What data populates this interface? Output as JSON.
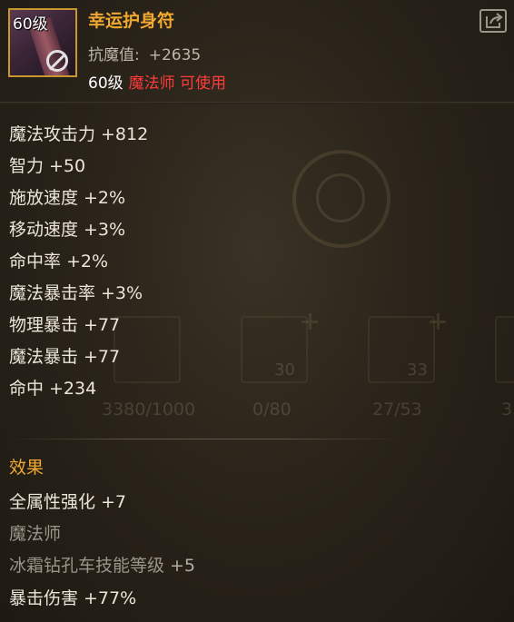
{
  "item": {
    "level_badge": "60级",
    "name": "幸运护身符",
    "resist_label": "抗魔值:",
    "resist_value": "+2635",
    "req_level": "60级",
    "req_class": "魔法师 可使用"
  },
  "stats": [
    {
      "label": "魔法攻击力",
      "value": "+812"
    },
    {
      "label": "智力",
      "value": "+50"
    },
    {
      "label": "施放速度",
      "value": "+2%"
    },
    {
      "label": "移动速度",
      "value": "+3%"
    },
    {
      "label": "命中率",
      "value": "+2%"
    },
    {
      "label": "魔法暴击率",
      "value": "+3%"
    },
    {
      "label": "物理暴击",
      "value": "+77"
    },
    {
      "label": "魔法暴击",
      "value": "+77"
    },
    {
      "label": "命中",
      "value": "+234"
    }
  ],
  "effects": {
    "title": "效果",
    "lines": [
      {
        "label": "全属性强化",
        "value": "+7"
      },
      {
        "label": "魔法师",
        "value": ""
      },
      {
        "label": "冰霜钻孔车技能等级",
        "value": "+5"
      },
      {
        "label": "暴击伤害",
        "value": "+77%"
      }
    ]
  },
  "background_text": [
    "30",
    "33",
    "3380/1000",
    "0/80",
    "27/53",
    "3"
  ],
  "icons": {
    "share": "share-icon",
    "item": "amulet-icon",
    "no_trade": "no-trade-icon"
  },
  "colors": {
    "item_name": "#f0a830",
    "class_req": "#ff3b3b",
    "effect_title": "#f0a830",
    "icon_border": "#c9962f"
  }
}
